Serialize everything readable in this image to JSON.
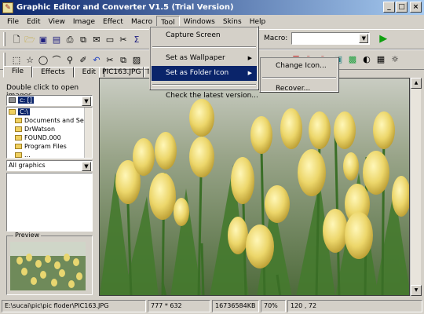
{
  "window": {
    "title": "Graphic Editor and Converter V1.5 (Trial Version)",
    "min": "_",
    "max": "□",
    "close": "×"
  },
  "menubar": [
    "File",
    "Edit",
    "View",
    "Image",
    "Effect",
    "Macro",
    "Tool",
    "Windows",
    "Skins",
    "Help"
  ],
  "toolbar": {
    "macro_label": "Macro:",
    "macro_value": ""
  },
  "tool_menu": {
    "items": [
      "Capture Screen",
      "Set as Wallpaper",
      "Set as Folder Icon",
      "Check the latest version..."
    ]
  },
  "submenu": {
    "items": [
      "Change Icon...",
      "Recover..."
    ]
  },
  "left": {
    "tabs": [
      "File",
      "Effects",
      "Edit"
    ],
    "hint": "Double click to open images",
    "drive": "c: []",
    "folders": [
      "C:\\",
      "Documents and Setti",
      "DrWatson",
      "FOUND.000",
      "Program Files",
      "..."
    ],
    "filter": "All graphics",
    "preview_label": "Preview"
  },
  "doctab": {
    "label": "PIC163.JPG",
    "next": "Im"
  },
  "status": {
    "path": "E:\\sucai\\pic\\pic floder\\PIC163.JPG",
    "dims": "777 * 632",
    "size": "16736584KB",
    "zoom": "70%",
    "coords": "120 , 72"
  },
  "colors": {
    "title_start": "#0a246a",
    "title_end": "#a6caf0",
    "highlight": "#0a246a"
  }
}
